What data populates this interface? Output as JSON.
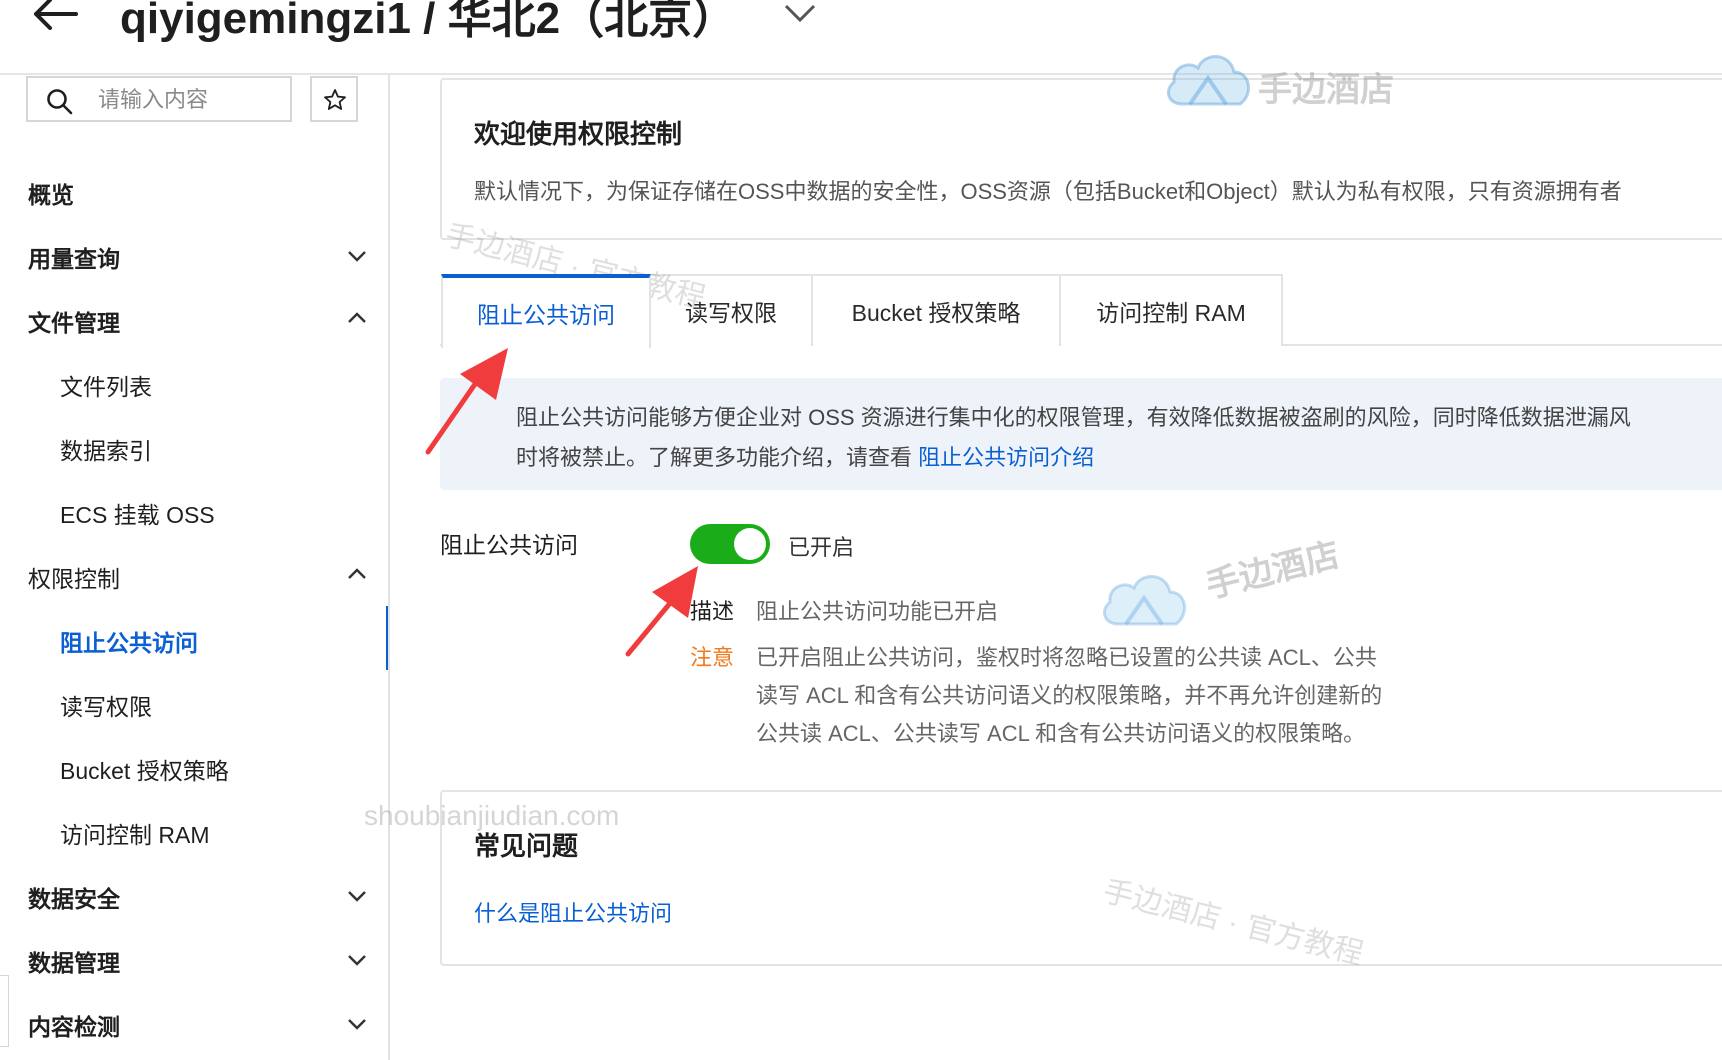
{
  "header": {
    "title": "qiyigemingzi1 / 华北2（北京）"
  },
  "sidebar": {
    "search": {
      "placeholder": "请输入内容",
      "value": ""
    },
    "items": [
      {
        "label": "概览",
        "type": "group"
      },
      {
        "label": "用量查询",
        "type": "group",
        "expanded": false
      },
      {
        "label": "文件管理",
        "type": "group",
        "expanded": true
      },
      {
        "label": "文件列表",
        "type": "sub"
      },
      {
        "label": "数据索引",
        "type": "sub"
      },
      {
        "label": "ECS 挂载 OSS",
        "type": "sub"
      },
      {
        "label": "权限控制",
        "type": "group-plain",
        "expanded": true
      },
      {
        "label": "阻止公共访问",
        "type": "sub",
        "active": true
      },
      {
        "label": "读写权限",
        "type": "sub"
      },
      {
        "label": "Bucket 授权策略",
        "type": "sub"
      },
      {
        "label": "访问控制 RAM",
        "type": "sub"
      },
      {
        "label": "数据安全",
        "type": "group",
        "expanded": false
      },
      {
        "label": "数据管理",
        "type": "group",
        "expanded": false
      },
      {
        "label": "内容检测",
        "type": "group",
        "expanded": false
      }
    ]
  },
  "welcome": {
    "title": "欢迎使用权限控制",
    "description": "默认情况下，为保证存储在OSS中数据的安全性，OSS资源（包括Bucket和Object）默认为私有权限，只有资源拥有者"
  },
  "tabs": [
    {
      "label": "阻止公共访问",
      "active": true
    },
    {
      "label": "读写权限",
      "active": false
    },
    {
      "label": "Bucket 授权策略",
      "active": false
    },
    {
      "label": "访问控制 RAM",
      "active": false
    }
  ],
  "info": {
    "line1": "阻止公共访问能够方便企业对 OSS 资源进行集中化的权限管理，有效降低数据被盗刷的风险，同时降低数据泄漏风",
    "line2_prefix": "时将被禁止。了解更多功能介绍，请查看 ",
    "line2_link": "阻止公共访问介绍"
  },
  "setting": {
    "label": "阻止公共访问",
    "enabled": true,
    "status": "已开启",
    "desc_key": "描述",
    "desc_value": "阻止公共访问功能已开启",
    "note_key": "注意",
    "note_lines": [
      "已开启阻止公共访问，鉴权时将忽略已设置的公共读 ACL、公共",
      "读写 ACL 和含有公共访问语义的权限策略，并不再允许创建新的",
      "公共读 ACL、公共读写 ACL 和含有公共访问语义的权限策略。"
    ]
  },
  "faq": {
    "title": "常见问题",
    "link": "什么是阻止公共访问"
  },
  "watermarks": {
    "logo_text": "手边酒店",
    "tutorial_text": "手边酒店 · 官方教程",
    "url": "shoubianjiudian.com"
  },
  "colors": {
    "accent": "#0a5fd3",
    "toggle_on": "#1aad19",
    "note": "#f27a1a",
    "annotation_arrow": "#f03c3c"
  }
}
